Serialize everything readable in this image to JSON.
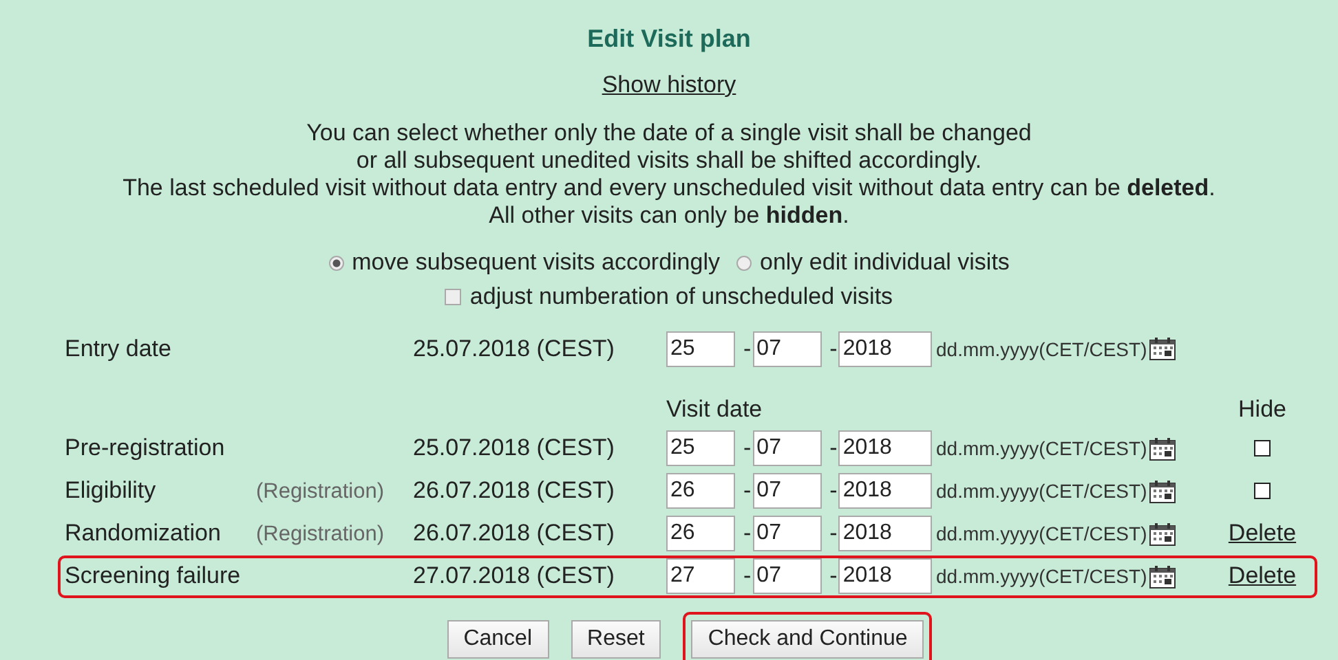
{
  "title": "Edit Visit plan",
  "history_link": "Show history",
  "intro_lines": [
    "You can select whether only the date of a single visit shall be changed",
    "or all subsequent unedited visits shall be shifted accordingly.",
    "The last scheduled visit without data entry and every unscheduled visit without data entry can be **deleted**.",
    "All other visits can only be **hidden**."
  ],
  "mode_options": [
    {
      "label": "move subsequent visits accordingly",
      "selected": true
    },
    {
      "label": "only edit individual visits",
      "selected": false
    }
  ],
  "renumber_option": {
    "label": "adjust numberation of unscheduled visits",
    "checked": false
  },
  "entry": {
    "name": "Entry date",
    "date": "25.07.2018 (CEST)",
    "day": "25",
    "month": "07",
    "year": "2018",
    "sep1": "-",
    "sep2": "-",
    "format": "dd.mm.yyyy(CET/CEST)"
  },
  "headers": {
    "visit_date": "Visit date",
    "hide": "Hide"
  },
  "visits": [
    {
      "name": "Pre-registration",
      "date": "25.07.2018 (CEST)",
      "day": "25",
      "month": "07",
      "year": "2018",
      "sep1": "-",
      "sep2": "-",
      "format": "dd.mm.yyyy(CET/CEST)",
      "kind": "hide",
      "checked": false,
      "highlighted": false
    },
    {
      "name": "Eligibility",
      "sub": "(Registration)",
      "date": "26.07.2018 (CEST)",
      "day": "26",
      "month": "07",
      "year": "2018",
      "sep1": "-",
      "sep2": "-",
      "format": "dd.mm.yyyy(CET/CEST)",
      "kind": "hide",
      "checked": false,
      "highlighted": false
    },
    {
      "name": "Randomization",
      "sub": "(Registration)",
      "date": "26.07.2018 (CEST)",
      "day": "26",
      "month": "07",
      "year": "2018",
      "sep1": "-",
      "sep2": "-",
      "format": "dd.mm.yyyy(CET/CEST)",
      "kind": "delete",
      "action": "Delete",
      "highlighted": false
    },
    {
      "name": "Screening failure",
      "date": "27.07.2018 (CEST)",
      "day": "27",
      "month": "07",
      "year": "2018",
      "sep1": "-",
      "sep2": "-",
      "format": "dd.mm.yyyy(CET/CEST)",
      "kind": "delete",
      "action": "Delete",
      "highlighted": true
    }
  ],
  "buttons": [
    {
      "label": "Cancel",
      "highlighted": false
    },
    {
      "label": "Reset",
      "highlighted": false
    },
    {
      "label": "Check and Continue",
      "highlighted": true
    }
  ]
}
